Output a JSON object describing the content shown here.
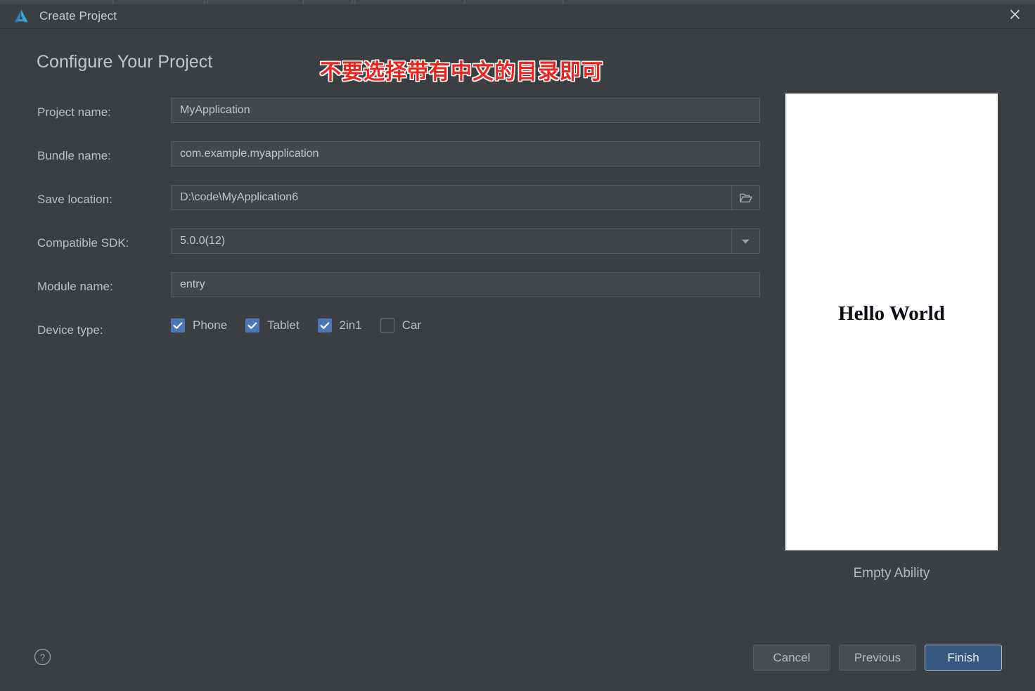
{
  "window": {
    "title": "Create Project",
    "app_icon": "deveco-studio-logo-icon",
    "close_icon": "close-icon"
  },
  "header": {
    "page_title": "Configure Your Project",
    "annotation_text": "不要选择带有中文的目录即可",
    "annotation_color": "#ec2420",
    "annotation_outline_color": "#ffffff"
  },
  "form": {
    "fields": [
      {
        "label": "Project name:",
        "value": "MyApplication",
        "type": "text"
      },
      {
        "label": "Bundle name:",
        "value": "com.example.myapplication",
        "type": "text"
      },
      {
        "label": "Save location:",
        "value": "D:\\code\\MyApplication6",
        "type": "path",
        "button_icon": "folder-browse-icon"
      },
      {
        "label": "Compatible SDK:",
        "value": "5.0.0(12)",
        "type": "select",
        "button_icon": "chevron-down-icon"
      },
      {
        "label": "Module name:",
        "value": "entry",
        "type": "text"
      }
    ],
    "device_type": {
      "label": "Device type:",
      "options": [
        {
          "label": "Phone",
          "checked": true
        },
        {
          "label": "Tablet",
          "checked": true
        },
        {
          "label": "2in1",
          "checked": true
        },
        {
          "label": "Car",
          "checked": false
        }
      ],
      "checked_color": "#4b77b8"
    }
  },
  "preview": {
    "screen_text": "Hello World",
    "caption": "Empty Ability"
  },
  "footer": {
    "help_icon": "help-circle-icon",
    "buttons": [
      {
        "label": "Cancel",
        "style": "secondary"
      },
      {
        "label": "Previous",
        "style": "secondary"
      },
      {
        "label": "Finish",
        "style": "primary"
      }
    ],
    "primary_color": "#365880"
  }
}
